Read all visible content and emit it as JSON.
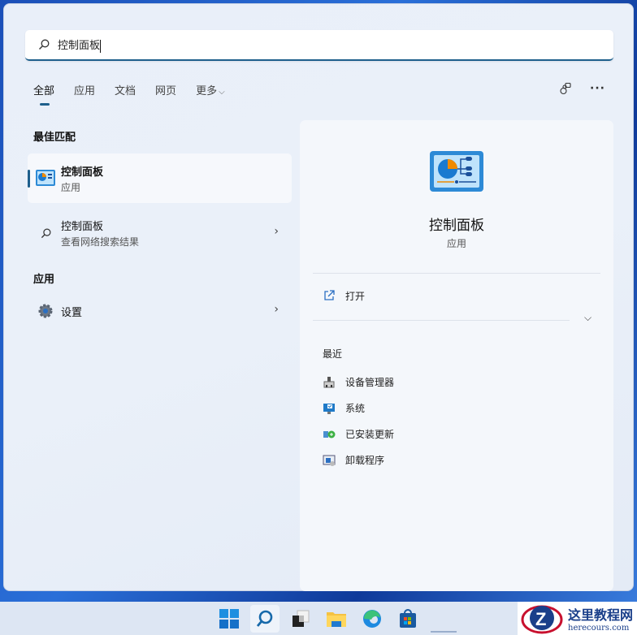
{
  "search": {
    "value": "控制面板"
  },
  "tabs": [
    {
      "label": "全部"
    },
    {
      "label": "应用"
    },
    {
      "label": "文档"
    },
    {
      "label": "网页"
    },
    {
      "label": "更多"
    }
  ],
  "left": {
    "best_match_heading": "最佳匹配",
    "best_match": {
      "title": "控制面板",
      "subtitle": "应用"
    },
    "web_result": {
      "title": "控制面板",
      "subtitle": "查看网络搜索结果"
    },
    "apps_heading": "应用",
    "apps": [
      {
        "title": "设置"
      }
    ]
  },
  "right": {
    "title": "控制面板",
    "subtitle": "应用",
    "open_label": "打开",
    "recent_heading": "最近",
    "recent": [
      {
        "label": "设备管理器"
      },
      {
        "label": "系统"
      },
      {
        "label": "已安装更新"
      },
      {
        "label": "卸载程序"
      }
    ]
  },
  "watermark": {
    "title": "这里教程网",
    "url": "herecours.com"
  },
  "colors": {
    "accent": "#1e5f8c"
  }
}
